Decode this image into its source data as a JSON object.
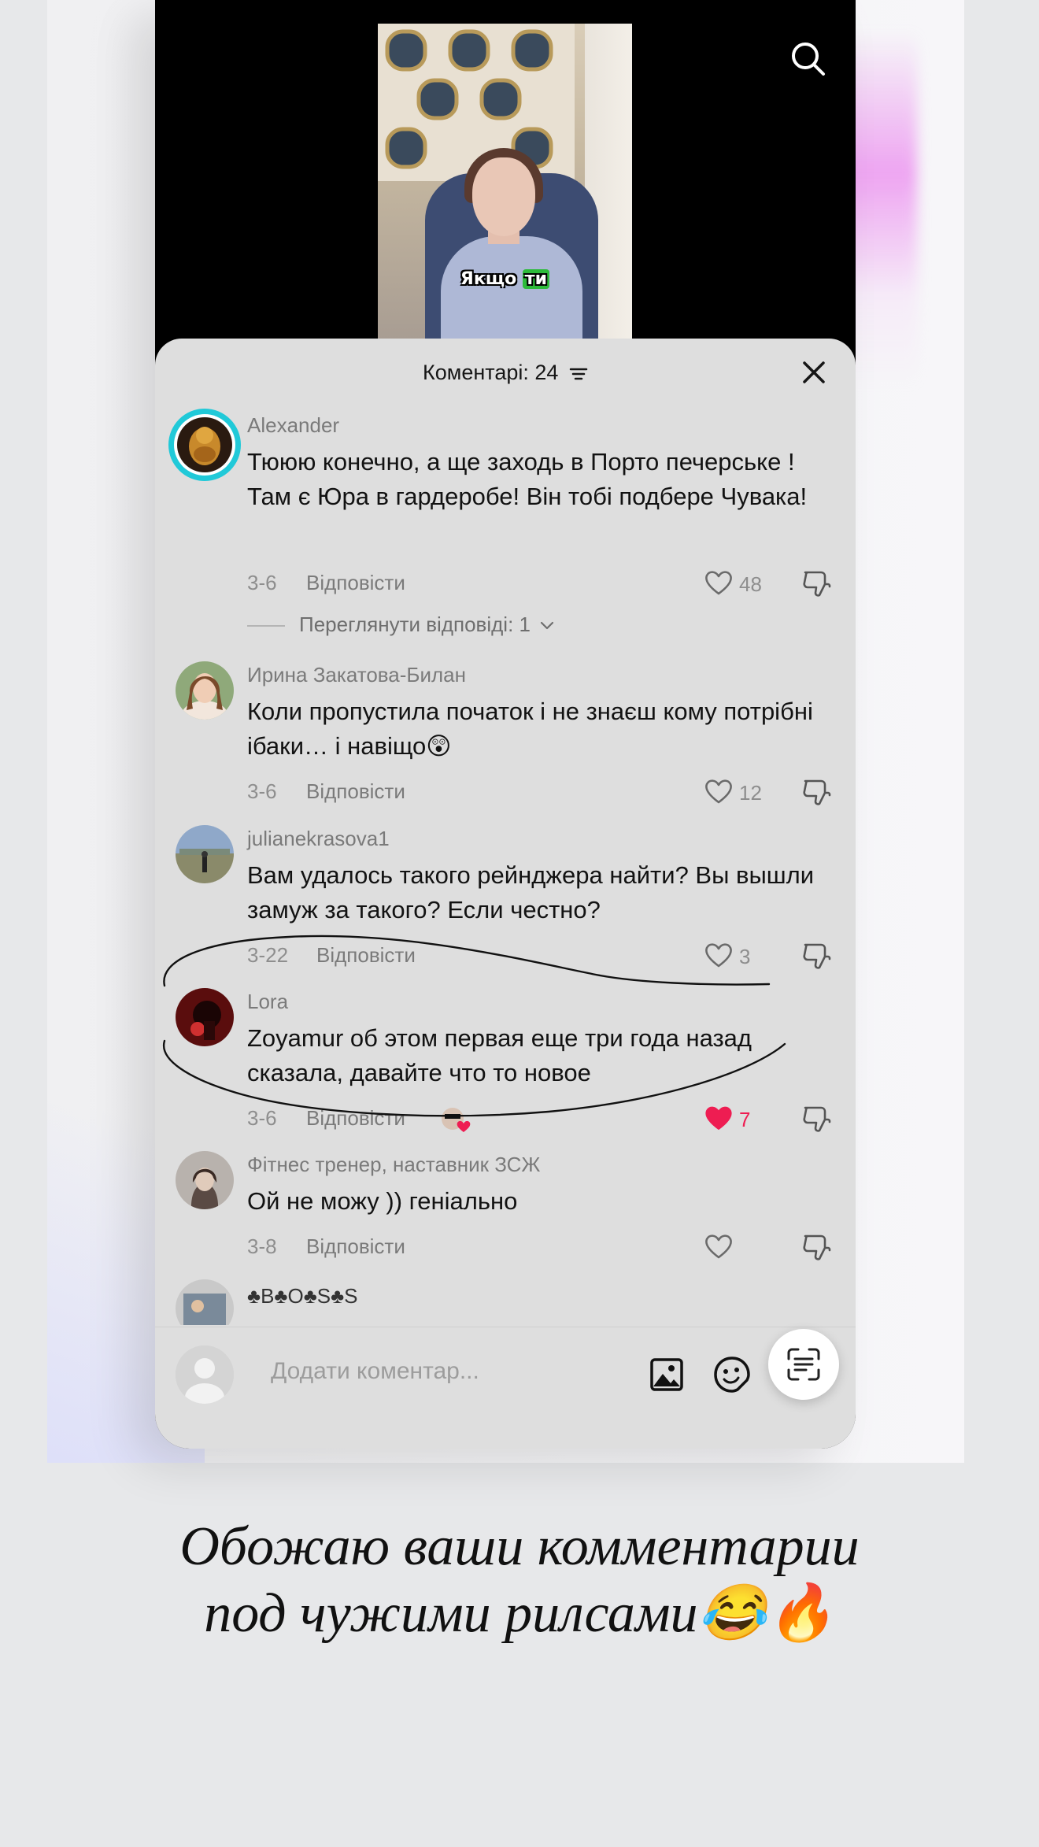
{
  "video": {
    "subtitle_prefix": "Якщо",
    "subtitle_highlight": "ти"
  },
  "comments_sheet": {
    "title": "Коментарі: 24",
    "comments": [
      {
        "author": "Alexander",
        "text": "Тююю конечно, а ще заходь в Порто печерське ! Там є Юра в гардеробе! Він тобі подбере Чувака!",
        "date": "3-6",
        "reply_label": "Відповісти",
        "likes": "48",
        "view_replies": "Переглянути відповіді: 1"
      },
      {
        "author": "Ирина Закатова-Билан",
        "text": "Коли пропустила початок і не знаєш кому потрібні ібаки… і навіщо😲",
        "date": "3-6",
        "reply_label": "Відповісти",
        "likes": "12"
      },
      {
        "author": "julianekrasova1",
        "text": "Вам удалось такого рейнджера найти? Вы вышли замуж за такого? Если честно?",
        "date": "3-22",
        "reply_label": "Відповісти",
        "likes": "3"
      },
      {
        "author": "Lora",
        "text": "Zoyamur об этом первая еще три года назад сказала, давайте что то новое",
        "date": "3-6",
        "reply_label": "Відповісти",
        "likes": "7"
      },
      {
        "author": "Фітнес тренер, наставник ЗСЖ",
        "text": "Ой не можу )) геніально",
        "date": "3-8",
        "reply_label": "Відповісти",
        "likes": ""
      },
      {
        "author": "♣B♣O♣S♣S"
      }
    ],
    "input_placeholder": "Додати коментар..."
  },
  "colors": {
    "sheet_bg": "#dedede",
    "liked_heart": "#ee1d52",
    "avatar_ring": "#20c9d8"
  },
  "caption": {
    "line1": "Обожаю ваши комментарии",
    "line2": "под чужими рилсами😂🔥"
  }
}
